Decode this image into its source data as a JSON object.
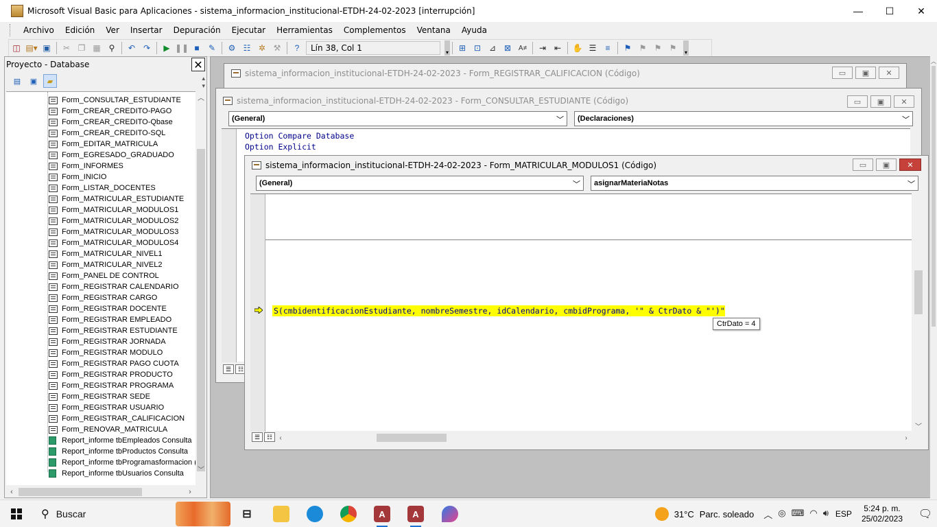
{
  "window": {
    "title": "Microsoft Visual Basic para Aplicaciones - sistema_informacion_institucional-ETDH-24-02-2023 [interrupción]",
    "minimize": "—",
    "maximize": "☐",
    "close": "✕"
  },
  "menu": [
    "Archivo",
    "Edición",
    "Ver",
    "Insertar",
    "Depuración",
    "Ejecutar",
    "Herramientas",
    "Complementos",
    "Ventana",
    "Ayuda"
  ],
  "toolbar": {
    "position": "Lín 38, Col 1"
  },
  "project": {
    "title": "Proyecto - Database",
    "items": [
      {
        "label": "Form_CONSULTAR_ESTUDIANTE",
        "type": "form"
      },
      {
        "label": "Form_CREAR_CREDITO-PAGO",
        "type": "form"
      },
      {
        "label": "Form_CREAR_CREDITO-Qbase",
        "type": "form"
      },
      {
        "label": "Form_CREAR_CREDITO-SQL",
        "type": "form"
      },
      {
        "label": "Form_EDITAR_MATRICULA",
        "type": "form"
      },
      {
        "label": "Form_EGRESADO_GRADUADO",
        "type": "form"
      },
      {
        "label": "Form_INFORMES",
        "type": "form"
      },
      {
        "label": "Form_INICIO",
        "type": "form"
      },
      {
        "label": "Form_LISTAR_DOCENTES",
        "type": "form"
      },
      {
        "label": "Form_MATRICULAR_ESTUDIANTE",
        "type": "form"
      },
      {
        "label": "Form_MATRICULAR_MODULOS1",
        "type": "form"
      },
      {
        "label": "Form_MATRICULAR_MODULOS2",
        "type": "form"
      },
      {
        "label": "Form_MATRICULAR_MODULOS3",
        "type": "form"
      },
      {
        "label": "Form_MATRICULAR_MODULOS4",
        "type": "form"
      },
      {
        "label": "Form_MATRICULAR_NIVEL1",
        "type": "form"
      },
      {
        "label": "Form_MATRICULAR_NIVEL2",
        "type": "form"
      },
      {
        "label": "Form_PANEL DE CONTROL",
        "type": "form"
      },
      {
        "label": "Form_REGISTRAR CALENDARIO",
        "type": "form"
      },
      {
        "label": "Form_REGISTRAR CARGO",
        "type": "form"
      },
      {
        "label": "Form_REGISTRAR DOCENTE",
        "type": "form"
      },
      {
        "label": "Form_REGISTRAR EMPLEADO",
        "type": "form"
      },
      {
        "label": "Form_REGISTRAR ESTUDIANTE",
        "type": "form"
      },
      {
        "label": "Form_REGISTRAR JORNADA",
        "type": "form"
      },
      {
        "label": "Form_REGISTRAR MODULO",
        "type": "form"
      },
      {
        "label": "Form_REGISTRAR PAGO CUOTA",
        "type": "form"
      },
      {
        "label": "Form_REGISTRAR PRODUCTO",
        "type": "form"
      },
      {
        "label": "Form_REGISTRAR PROGRAMA",
        "type": "form"
      },
      {
        "label": "Form_REGISTRAR SEDE",
        "type": "form"
      },
      {
        "label": "Form_REGISTRAR USUARIO",
        "type": "form"
      },
      {
        "label": "Form_REGISTRAR_CALIFICACION",
        "type": "form"
      },
      {
        "label": "Form_RENOVAR_MATRICULA",
        "type": "form"
      },
      {
        "label": "Report_informe tbEmpleados Consulta",
        "type": "report"
      },
      {
        "label": "Report_informe tbProductos Consulta",
        "type": "report"
      },
      {
        "label": "Report_informe tbProgramasformacion (",
        "type": "report"
      },
      {
        "label": "Report_informe tbUsuarios Consulta",
        "type": "report"
      }
    ]
  },
  "code_windows": {
    "w1": {
      "title": "sistema_informacion_institucional-ETDH-24-02-2023 - Form_REGISTRAR_CALIFICACION (Código)"
    },
    "w2": {
      "title": "sistema_informacion_institucional-ETDH-24-02-2023 - Form_CONSULTAR_ESTUDIANTE (Código)",
      "object_combo": "(General)",
      "proc_combo": "(Declaraciones)",
      "lines": [
        "Option Compare Database",
        "Option Explicit"
      ]
    },
    "w3": {
      "title": "sistema_informacion_institucional-ETDH-24-02-2023 - Form_MATRICULAR_MODULOS1 (Código)",
      "object_combo": "(General)",
      "proc_combo": "asignarMateriaNotas",
      "current_line": "S(cmbidentificacionEstudiante, nombreSemestre, idCalendario, cmbidPrograma, '\" & CtrDato & \"')\"",
      "tooltip": "CtrDato = 4"
    }
  },
  "colors": {
    "highlight": "#ffff00",
    "code_text": "#00008b",
    "close_red": "#c6413a"
  },
  "taskbar": {
    "search": "Buscar",
    "weather_temp": "31°C",
    "weather_desc": "Parc. soleado",
    "lang": "ESP",
    "time": "5:24 p. m.",
    "date": "25/02/2023"
  }
}
